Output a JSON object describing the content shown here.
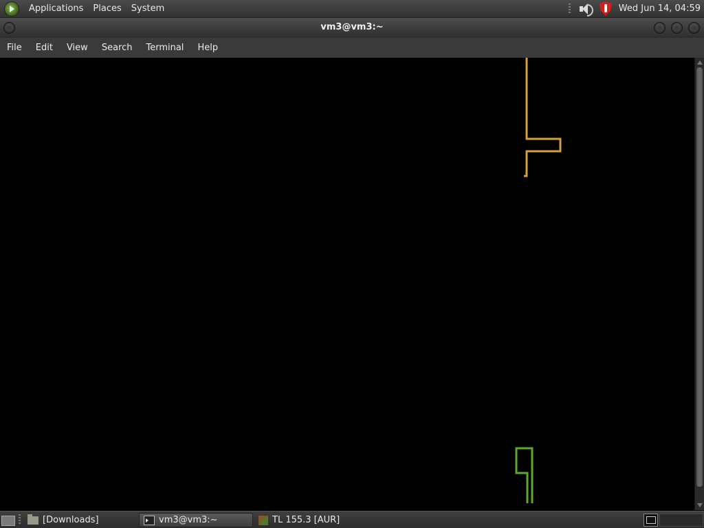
{
  "top_panel": {
    "menus": [
      "Applications",
      "Places",
      "System"
    ],
    "clock": "Wed Jun 14, 04:59",
    "icons": [
      "distro-logo-icon",
      "speaker-icon",
      "shield-icon"
    ]
  },
  "window": {
    "title": "vm3@vm3:~",
    "menu": [
      "File",
      "Edit",
      "View",
      "Search",
      "Terminal",
      "Help"
    ]
  },
  "terminal": {
    "colors": {
      "background": "#000000",
      "orange": "#d2a23c",
      "green": "#5ea82a"
    }
  },
  "taskbar": {
    "items": [
      {
        "label": "[Downloads]",
        "icon": "folder-icon",
        "active": false
      },
      {
        "label": "vm3@vm3:~",
        "icon": "terminal-icon",
        "active": true
      },
      {
        "label": "TL 155.3 [AUR]",
        "icon": "cube-icon",
        "active": false
      }
    ]
  }
}
